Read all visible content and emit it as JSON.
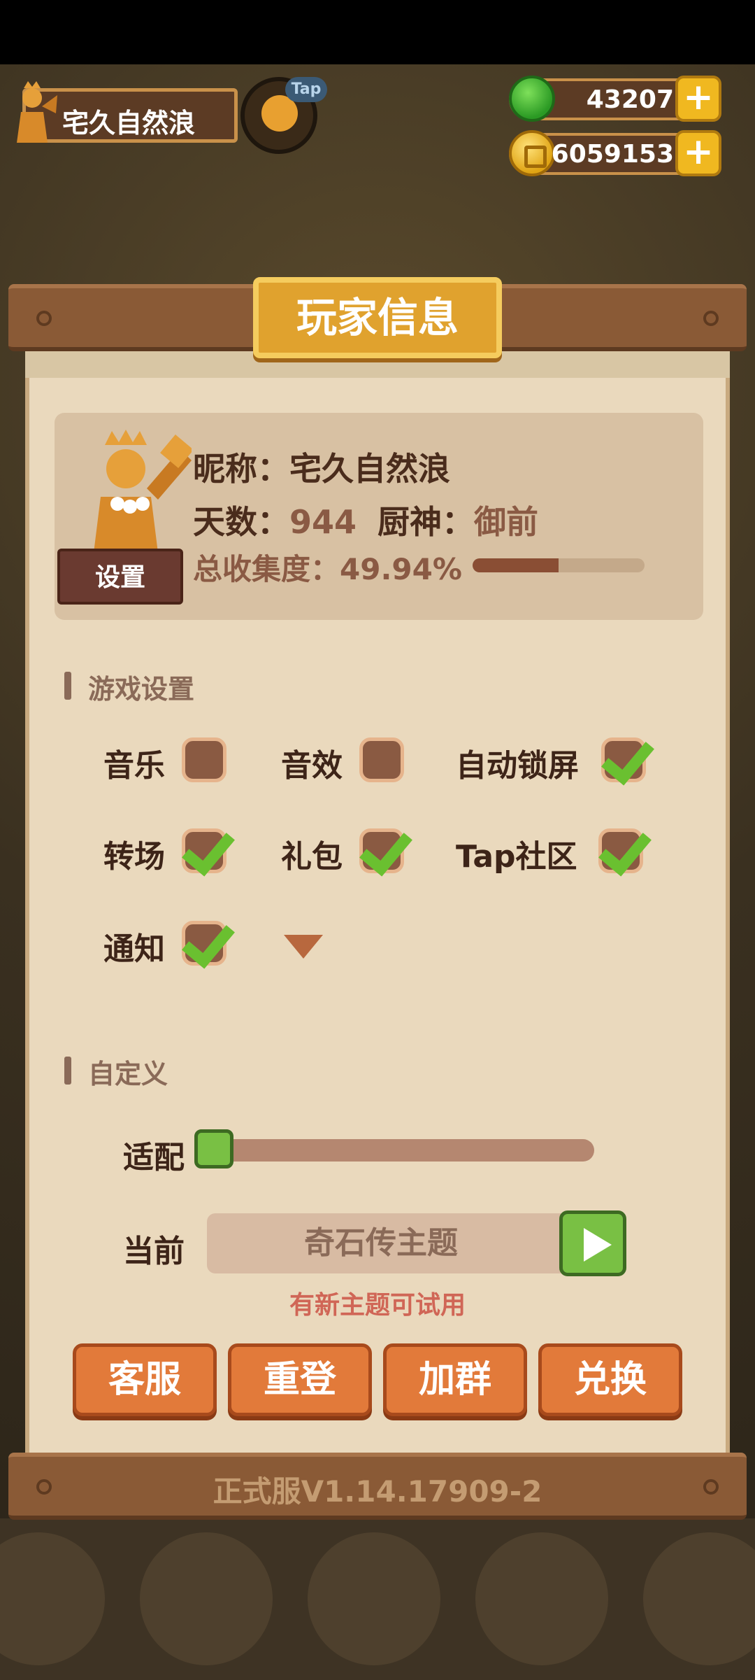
{
  "player": {
    "name": "宅久自然浪",
    "tap_badge": "Tap"
  },
  "currency": {
    "gems": "43207",
    "coins": "6059153",
    "plus": "+"
  },
  "panel": {
    "title": "玩家信息",
    "version": "正式服V1.14.17909-2"
  },
  "info": {
    "nickname_label": "昵称：",
    "nickname": "宅久自然浪",
    "days_label": "天数：",
    "days": "944",
    "chef_label": "厨神：",
    "chef": "御前",
    "collection_label": "总收集度：",
    "collection": "49.94%",
    "collection_fraction": 0.4994,
    "settings_button": "设置"
  },
  "game_settings": {
    "title": "游戏设置",
    "options": [
      {
        "label": "音乐",
        "checked": false
      },
      {
        "label": "音效",
        "checked": false
      },
      {
        "label": "自动锁屏",
        "checked": true
      },
      {
        "label": "转场",
        "checked": true
      },
      {
        "label": "礼包",
        "checked": true
      },
      {
        "label": "Tap社区",
        "checked": true
      },
      {
        "label": "通知",
        "checked": true
      }
    ]
  },
  "custom": {
    "title": "自定义",
    "fit_label": "适配",
    "fit_value": 0,
    "current_label": "当前",
    "current_theme": "奇石传主题",
    "new_theme_notice": "有新主题可试用"
  },
  "buttons": {
    "support": "客服",
    "relogin": "重登",
    "join_group": "加群",
    "redeem": "兑换"
  },
  "colors": {
    "accent_orange": "#e27a3a",
    "check_green": "#6ac030",
    "panel_bg": "#ead9bd"
  }
}
